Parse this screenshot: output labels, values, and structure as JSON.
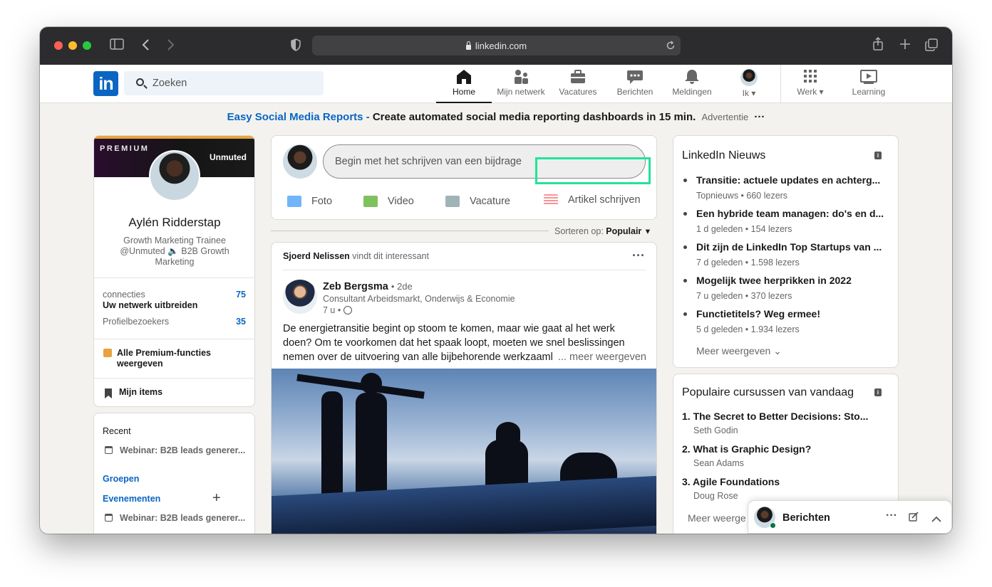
{
  "browser": {
    "url": "linkedin.com"
  },
  "nav": {
    "search_placeholder": "Zoeken",
    "items": [
      {
        "label": "Home",
        "icon": "home-icon"
      },
      {
        "label": "Mijn netwerk",
        "icon": "network-icon"
      },
      {
        "label": "Vacatures",
        "icon": "briefcase-icon"
      },
      {
        "label": "Berichten",
        "icon": "chat-icon"
      },
      {
        "label": "Meldingen",
        "icon": "bell-icon"
      },
      {
        "label": "Ik",
        "icon": "avatar"
      },
      {
        "label": "Werk",
        "icon": "grid-icon"
      },
      {
        "label": "Learning",
        "icon": "learning-icon"
      }
    ]
  },
  "ad": {
    "link": "Easy Social Media Reports",
    "dash": " - ",
    "text": "Create automated social media reporting dashboards in 15 min.",
    "tag": "Advertentie",
    "more": "···"
  },
  "profile": {
    "premium": "PREMIUM",
    "banner_brand": "Unmuted",
    "name": "Aylén Ridderstap",
    "headline": "Growth Marketing Trainee @Unmuted 🔈 B2B Growth Marketing",
    "connections_label": "connecties",
    "connections_sub": "Uw netwerk uitbreiden",
    "connections_count": "75",
    "visitors_label": "Profielbezoekers",
    "visitors_count": "35",
    "premium_features": "Alle Premium-functies weergeven",
    "my_items": "Mijn items"
  },
  "left_lower": {
    "recent": "Recent",
    "recent_item": "Webinar: B2B leads generer...",
    "groups": "Groepen",
    "events": "Evenementen",
    "events_item": "Webinar: B2B leads generer..."
  },
  "composer": {
    "placeholder": "Begin met het schrijven van een bijdrage",
    "actions": [
      "Foto",
      "Video",
      "Vacature",
      "Artikel schrijven"
    ]
  },
  "sort": {
    "label": "Sorteren op:",
    "value": "Populair"
  },
  "post": {
    "context_name": "Sjoerd Nelissen",
    "context_text": " vindt dit interessant",
    "author": "Zeb Bergsma",
    "degree": "• 2de",
    "headline": "Consultant Arbeidsmarkt, Onderwijs & Economie",
    "time": "7 u •",
    "body": "De energietransitie begint op stoom te komen, maar wie gaat al het werk doen? Om te voorkomen dat het spaak loopt, moeten we snel beslissingen nemen over de uitvoering van alle bijbehorende werkzaaml",
    "more": "... meer weergeven"
  },
  "news": {
    "title": "LinkedIn Nieuws",
    "items": [
      {
        "title": "Transitie: actuele updates en achterg...",
        "meta": "Topnieuws • 660 lezers"
      },
      {
        "title": "Een hybride team managen: do's en d...",
        "meta": "1 d geleden • 154 lezers"
      },
      {
        "title": "Dit zijn de LinkedIn Top Startups van ...",
        "meta": "7 d geleden • 1.598 lezers"
      },
      {
        "title": "Mogelijk twee herprikken in 2022",
        "meta": "7 u geleden • 370 lezers"
      },
      {
        "title": "Functietitels? Weg ermee!",
        "meta": "5 d geleden • 1.934 lezers"
      }
    ],
    "more": "Meer weergeven"
  },
  "courses": {
    "title": "Populaire cursussen van vandaag",
    "items": [
      {
        "title": "1. The Secret to Better Decisions: Sto...",
        "author": "Seth Godin"
      },
      {
        "title": "2. What is Graphic Design?",
        "author": "Sean Adams"
      },
      {
        "title": "3. Agile Foundations",
        "author": "Doug Rose"
      }
    ],
    "more": "Meer weerge"
  },
  "messaging": {
    "title": "Berichten"
  },
  "colors": {
    "linkedin_blue": "#0a66c2",
    "highlight": "#22e39a",
    "premium_gold": "#e7a33e"
  }
}
